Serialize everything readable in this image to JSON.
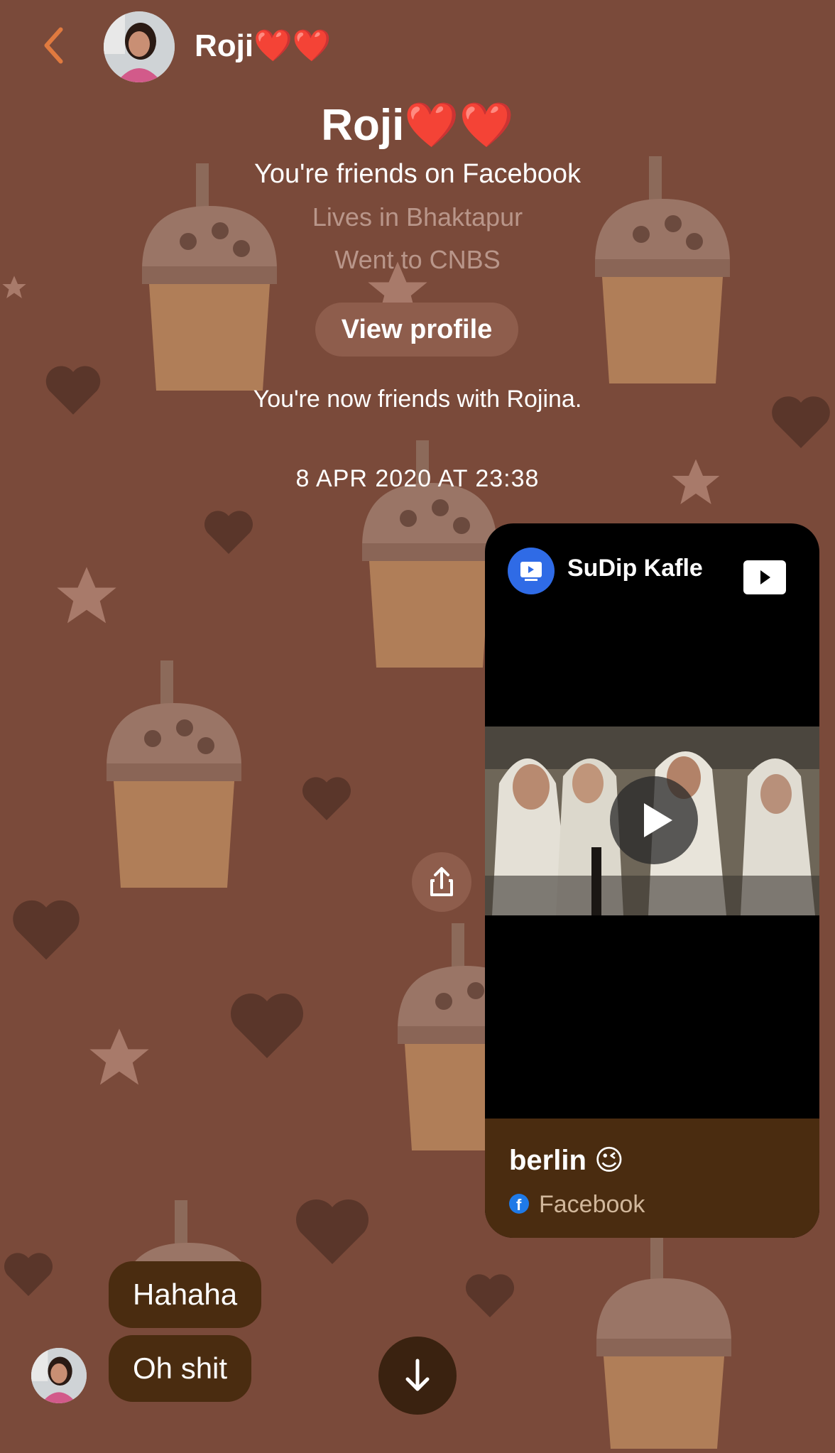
{
  "header": {
    "name": "Roji",
    "hearts": "❤️❤️",
    "back_icon": "chevron-left-icon",
    "accent_color": "#e07a3f"
  },
  "profile": {
    "name": "Roji",
    "hearts": "❤️❤️",
    "friends_line": "You're friends on Facebook",
    "lives": "Lives in Bhaktapur",
    "went": "Went to CNBS",
    "view_profile_label": "View profile"
  },
  "events": {
    "now_friends": "You're now friends with Rojina.",
    "timestamp": "8 APR 2020 AT 23:38"
  },
  "shared_card": {
    "channel": "SuDip Kafle",
    "title": "berlin 😉",
    "source": "Facebook",
    "icons": [
      "tv-icon",
      "youtube-play-icon",
      "play-icon",
      "facebook-icon",
      "share-icon"
    ]
  },
  "messages": [
    {
      "text": "Hahaha"
    },
    {
      "text": "Oh shit"
    }
  ],
  "controls": {
    "scroll_down_icon": "arrow-down-icon"
  },
  "colors": {
    "background": "#7a4a3a",
    "bubble": "#4a2c10",
    "secondary_text": "#b9968a"
  }
}
